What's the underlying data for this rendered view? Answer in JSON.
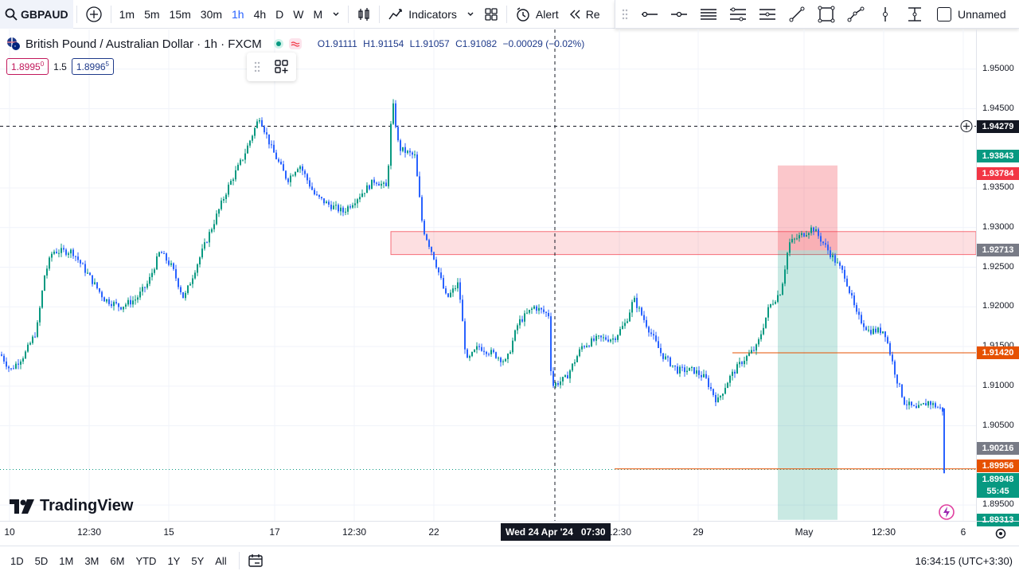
{
  "toolbar": {
    "symbol": "GBPAUD",
    "timeframes": [
      "1m",
      "5m",
      "15m",
      "30m",
      "1h",
      "4h",
      "D",
      "W",
      "M"
    ],
    "active_timeframe": "1h",
    "indicators_label": "Indicators",
    "alert_label": "Alert",
    "replay_label": "Re"
  },
  "drawing": {
    "layout_name": "Unnamed"
  },
  "legend": {
    "title": "British Pound / Australian Dollar · 1h · FXCM",
    "open": "O1.91111",
    "high": "H1.91154",
    "low": "L1.91057",
    "close": "C1.91082",
    "change": "−0.00029 (−0.02%)",
    "sell_price": "1.8995",
    "sell_sup": "0",
    "spread": "1.5",
    "buy_price": "1.8996",
    "buy_sup": "5"
  },
  "price_axis": {
    "ticks": [
      "1.95000",
      "1.94500",
      "1.93500",
      "1.93000",
      "1.92500",
      "1.92000",
      "1.91500",
      "1.91000",
      "1.90500",
      "1.89500"
    ],
    "labels": [
      {
        "text": "1.94279",
        "color": "#131722"
      },
      {
        "text": "1.93843",
        "color": "#089981"
      },
      {
        "text": "1.93784",
        "color": "#f23645"
      },
      {
        "text": "1.92713",
        "color": "#787b86"
      },
      {
        "text": "1.91420",
        "color": "#e65100"
      },
      {
        "text": "1.90216",
        "color": "#787b86"
      },
      {
        "text": "1.89956",
        "color": "#e65100"
      },
      {
        "text": "1.89948",
        "color": "#089981"
      },
      {
        "text": "55:45",
        "color": "#089981"
      },
      {
        "text": "1.89313",
        "color": "#089981"
      }
    ]
  },
  "time_axis": {
    "ticks": [
      "10",
      "12:30",
      "15",
      "17",
      "12:30",
      "22",
      "12:30",
      "29",
      "May",
      "12:30",
      "6"
    ],
    "crosshair_label": "Wed 24 Apr '24   07:30"
  },
  "bottom_bar": {
    "ranges": [
      "1D",
      "5D",
      "1M",
      "3M",
      "6M",
      "YTD",
      "1Y",
      "5Y",
      "All"
    ],
    "clock": "16:34:15 (UTC+3:30)"
  },
  "brand": "TradingView",
  "colors": {
    "up": "#089981",
    "down": "#2962ff",
    "accent": "#2962ff",
    "zone_red": "#f23645",
    "zone_green": "#089981"
  },
  "chart_data": {
    "type": "candlestick",
    "symbol": "GBPAUD",
    "interval": "1h",
    "ylim": [
      1.893,
      1.955
    ],
    "y_ticks": [
      1.895,
      1.905,
      1.91,
      1.915,
      1.92,
      1.925,
      1.93,
      1.935,
      1.945,
      1.95
    ],
    "price_path": [
      [
        0,
        1.914
      ],
      [
        12,
        1.912
      ],
      [
        30,
        1.914
      ],
      [
        45,
        1.917
      ],
      [
        55,
        1.924
      ],
      [
        65,
        1.927
      ],
      [
        90,
        1.927
      ],
      [
        110,
        1.924
      ],
      [
        130,
        1.921
      ],
      [
        150,
        1.92
      ],
      [
        170,
        1.921
      ],
      [
        185,
        1.923
      ],
      [
        200,
        1.927
      ],
      [
        215,
        1.925
      ],
      [
        230,
        1.921
      ],
      [
        245,
        1.925
      ],
      [
        265,
        1.93
      ],
      [
        285,
        1.935
      ],
      [
        305,
        1.939
      ],
      [
        325,
        1.944
      ],
      [
        340,
        1.94
      ],
      [
        360,
        1.936
      ],
      [
        375,
        1.938
      ],
      [
        395,
        1.934
      ],
      [
        410,
        1.933
      ],
      [
        430,
        1.932
      ],
      [
        450,
        1.934
      ],
      [
        470,
        1.936
      ],
      [
        485,
        1.935
      ],
      [
        492,
        1.946
      ],
      [
        500,
        1.94
      ],
      [
        520,
        1.939
      ],
      [
        530,
        1.93
      ],
      [
        545,
        1.926
      ],
      [
        560,
        1.921
      ],
      [
        575,
        1.923
      ],
      [
        585,
        1.913
      ],
      [
        600,
        1.915
      ],
      [
        620,
        1.914
      ],
      [
        635,
        1.913
      ],
      [
        650,
        1.918
      ],
      [
        670,
        1.92
      ],
      [
        688,
        1.919
      ],
      [
        692,
        1.91
      ],
      [
        710,
        1.911
      ],
      [
        730,
        1.915
      ],
      [
        750,
        1.916
      ],
      [
        770,
        1.916
      ],
      [
        785,
        1.918
      ],
      [
        795,
        1.921
      ],
      [
        810,
        1.918
      ],
      [
        830,
        1.914
      ],
      [
        850,
        1.912
      ],
      [
        870,
        1.912
      ],
      [
        885,
        1.911
      ],
      [
        900,
        1.908
      ],
      [
        915,
        1.911
      ],
      [
        930,
        1.913
      ],
      [
        950,
        1.915
      ],
      [
        965,
        1.92
      ],
      [
        980,
        1.922
      ],
      [
        990,
        1.928
      ],
      [
        1005,
        1.929
      ],
      [
        1020,
        1.93
      ],
      [
        1040,
        1.927
      ],
      [
        1060,
        1.924
      ],
      [
        1075,
        1.919
      ],
      [
        1090,
        1.917
      ],
      [
        1110,
        1.917
      ],
      [
        1125,
        1.911
      ],
      [
        1135,
        1.908
      ],
      [
        1150,
        1.907
      ],
      [
        1165,
        1.908
      ],
      [
        1183,
        1.907
      ],
      [
        1186,
        1.8995
      ]
    ],
    "last_price": 1.89948,
    "horizontal_lines": [
      1.94279,
      1.9142,
      1.89956
    ],
    "zones": [
      {
        "kind": "supply",
        "from": 1.9266,
        "to": 1.9295
      },
      {
        "kind": "short_stop",
        "from": 1.92713,
        "to": 1.93784
      },
      {
        "kind": "short_target",
        "from": 1.89313,
        "to": 1.92713
      }
    ]
  }
}
